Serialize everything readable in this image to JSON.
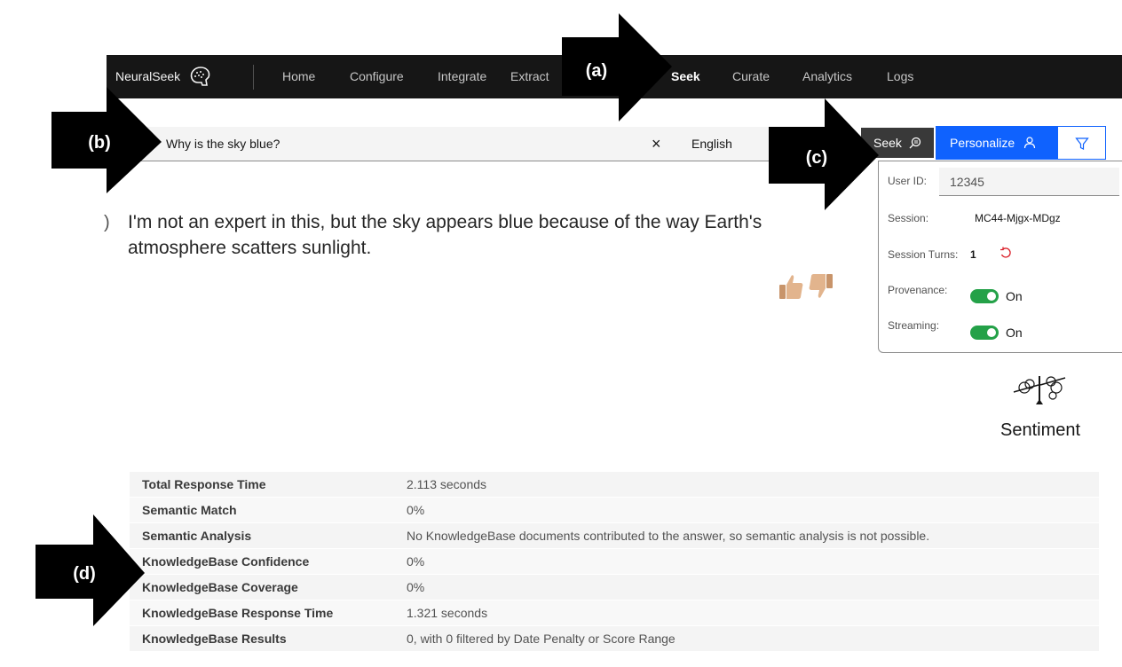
{
  "nav": {
    "brand": "NeuralSeek",
    "items": [
      "Home",
      "Configure",
      "Integrate",
      "Extract",
      "Seek",
      "Curate",
      "Analytics",
      "Logs"
    ],
    "active": "Seek"
  },
  "search": {
    "query": "Why is the sky blue?",
    "language": "English",
    "clear_glyph": "×"
  },
  "answer": {
    "text": "I'm not an expert in this, but the sky appears blue because of the way Earth's atmosphere scatters sunlight."
  },
  "buttons": {
    "seek": "Seek",
    "personalize": "Personalize"
  },
  "panel": {
    "user_id_label": "User ID:",
    "user_id_value": "12345",
    "session_label": "Session:",
    "session_value": "MC44-Mjgx-MDgz",
    "session_turns_label": "Session Turns:",
    "session_turns_value": "1",
    "provenance_label": "Provenance:",
    "provenance_state": "On",
    "streaming_label": "Streaming:",
    "streaming_state": "On"
  },
  "sentiment": {
    "label": "Sentiment"
  },
  "stats": [
    {
      "key": "Total Response Time",
      "value": "2.113 seconds"
    },
    {
      "key": "Semantic Match",
      "value": "0%"
    },
    {
      "key": "Semantic Analysis",
      "value": "No KnowledgeBase documents contributed to the answer, so semantic analysis is not possible."
    },
    {
      "key": "KnowledgeBase Confidence",
      "value": "0%"
    },
    {
      "key": "KnowledgeBase Coverage",
      "value": "0%"
    },
    {
      "key": "KnowledgeBase Response Time",
      "value": "1.321 seconds"
    },
    {
      "key": "KnowledgeBase Results",
      "value": "0, with 0 filtered by Date Penalty or Score Range"
    }
  ],
  "callouts": {
    "a": "(a)",
    "b": "(b)",
    "c": "(c)",
    "d": "(d)"
  },
  "icons": {
    "brand": "brain-logo-icon",
    "seek": "search-icon",
    "personalize": "user-icon",
    "filter": "filter-icon",
    "reset": "reset-icon",
    "thumbs_up": "thumbs-up-icon",
    "thumbs_down": "thumbs-down-icon",
    "sentiment": "sentiment-icon"
  },
  "colors": {
    "primary": "#0f62fe",
    "nav_bg": "#161616",
    "toggle_on": "#24a148",
    "reset": "#da1e28"
  }
}
